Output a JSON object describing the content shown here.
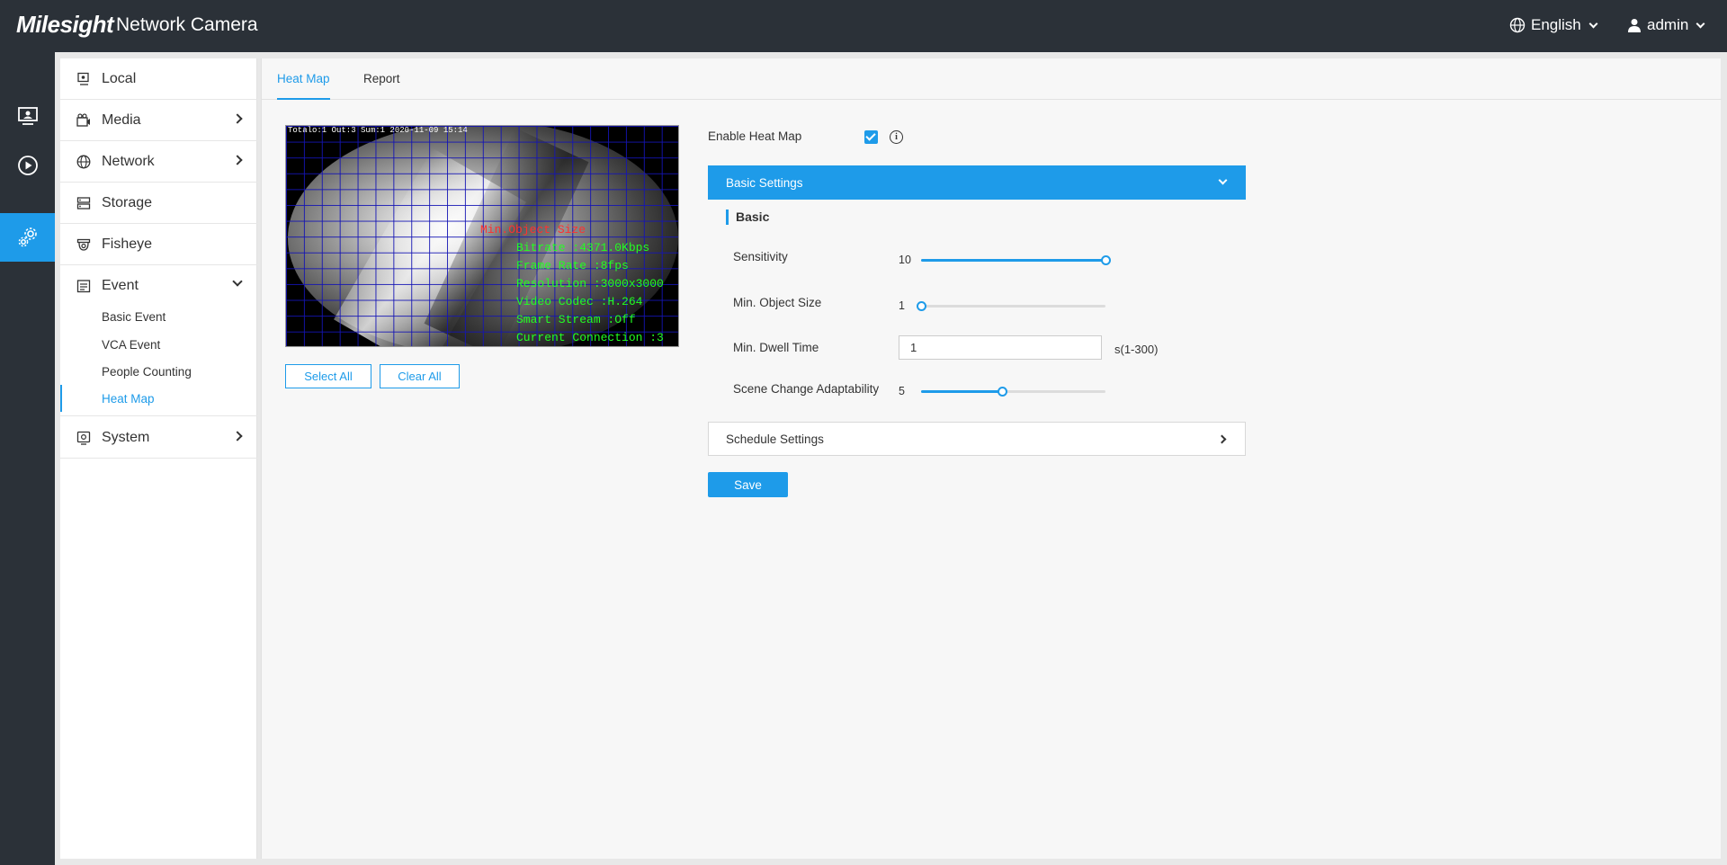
{
  "header": {
    "brand": "Milesight",
    "product": "Network Camera",
    "language": "English",
    "user": "admin"
  },
  "rail": {
    "items": [
      {
        "icon": "live-view-icon"
      },
      {
        "icon": "playback-icon"
      },
      {
        "icon": "settings-icon",
        "active": true
      }
    ]
  },
  "sidebar": {
    "items": [
      {
        "label": "Local",
        "icon": "local-icon"
      },
      {
        "label": "Media",
        "icon": "media-icon"
      },
      {
        "label": "Network",
        "icon": "globe-icon"
      },
      {
        "label": "Storage",
        "icon": "storage-icon"
      },
      {
        "label": "Fisheye",
        "icon": "fisheye-icon"
      },
      {
        "label": "Event",
        "icon": "event-icon"
      },
      {
        "label": "System",
        "icon": "system-icon"
      }
    ],
    "event_sub": [
      {
        "label": "Basic Event"
      },
      {
        "label": "VCA Event"
      },
      {
        "label": "People Counting"
      },
      {
        "label": "Heat Map",
        "active": true
      }
    ]
  },
  "tabs": [
    {
      "label": "Heat Map",
      "active": true
    },
    {
      "label": "Report"
    }
  ],
  "video": {
    "osd_top": "Totalo:1  Out:3  Sum:1 2020-11-09 15:14",
    "osd_red": "Min.Object Size",
    "osd_lines": [
      "Bitrate :4371.0Kbps",
      "Frame Rate :8fps",
      "Resolution :3000x3000",
      "Video Codec :H.264",
      "Smart Stream :Off",
      "Current Connection :3"
    ]
  },
  "buttons": {
    "select_all": "Select All",
    "clear_all": "Clear All",
    "save": "Save"
  },
  "settings": {
    "enable_heat_map_label": "Enable Heat Map",
    "enable_heat_map": true,
    "basic_settings_title": "Basic Settings",
    "basic_section": "Basic",
    "sensitivity": {
      "label": "Sensitivity",
      "value": "10",
      "fraction": 1.0
    },
    "min_object_size": {
      "label": "Min. Object Size",
      "value": "1",
      "fraction": 0.0
    },
    "min_dwell_time": {
      "label": "Min. Dwell Time",
      "value": "1",
      "unit": "s(1-300)"
    },
    "scene_change": {
      "label": "Scene Change Adaptability",
      "value": "5",
      "fraction": 0.44
    },
    "schedule_settings_title": "Schedule Settings"
  },
  "colors": {
    "accent": "#1e9be9",
    "header_bg": "#2b3138"
  }
}
